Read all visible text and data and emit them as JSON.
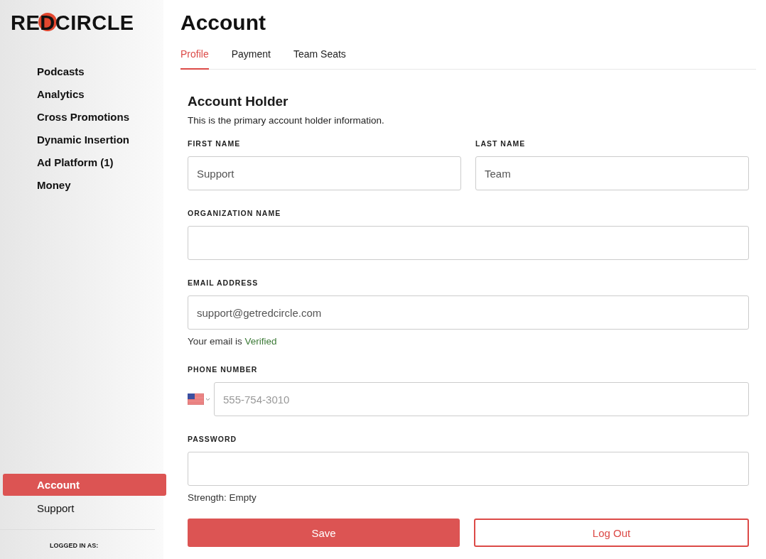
{
  "logo": {
    "text_before": "RE",
    "text_circled": "D",
    "text_after": "CIRCLE"
  },
  "sidebar": {
    "items": [
      {
        "label": "Podcasts",
        "selected": false
      },
      {
        "label": "Analytics",
        "selected": false
      },
      {
        "label": "Cross Promotions",
        "selected": false
      },
      {
        "label": "Dynamic Insertion",
        "selected": false
      },
      {
        "label": "Ad Platform (1)",
        "selected": false
      },
      {
        "label": "Money",
        "selected": false
      }
    ],
    "bottom_items": [
      {
        "label": "Account",
        "selected": true
      },
      {
        "label": "Support",
        "selected": false
      }
    ],
    "logged_in_label": "LOGGED IN AS:"
  },
  "page": {
    "title": "Account"
  },
  "tabs": [
    {
      "label": "Profile",
      "selected": true
    },
    {
      "label": "Payment",
      "selected": false
    },
    {
      "label": "Team Seats",
      "selected": false
    }
  ],
  "section": {
    "title": "Account Holder",
    "description": "This is the primary account holder information."
  },
  "rows": [
    {
      "fields": [
        {
          "kind": "text",
          "label": "FIRST NAME",
          "value": "Support"
        },
        {
          "kind": "text",
          "label": "LAST NAME",
          "value": "Team"
        }
      ]
    },
    {
      "fields": [
        {
          "kind": "text",
          "label": "ORGANIZATION NAME"
        }
      ]
    },
    {
      "fields": [
        {
          "kind": "text",
          "label": "EMAIL ADDRESS",
          "value": "support@getredcircle.com",
          "note": "Your email is ",
          "note_status": "Verified"
        }
      ]
    },
    {
      "fields": [
        {
          "kind": "phone",
          "label": "PHONE NUMBER",
          "placeholder": "555-754-3010"
        }
      ]
    },
    {
      "fields": [
        {
          "kind": "password",
          "label": "PASSWORD",
          "note": "Strength: Empty"
        }
      ]
    }
  ],
  "buttons": [
    {
      "label": "Save",
      "kind": "primary"
    },
    {
      "label": "Log Out",
      "kind": "outline"
    }
  ]
}
